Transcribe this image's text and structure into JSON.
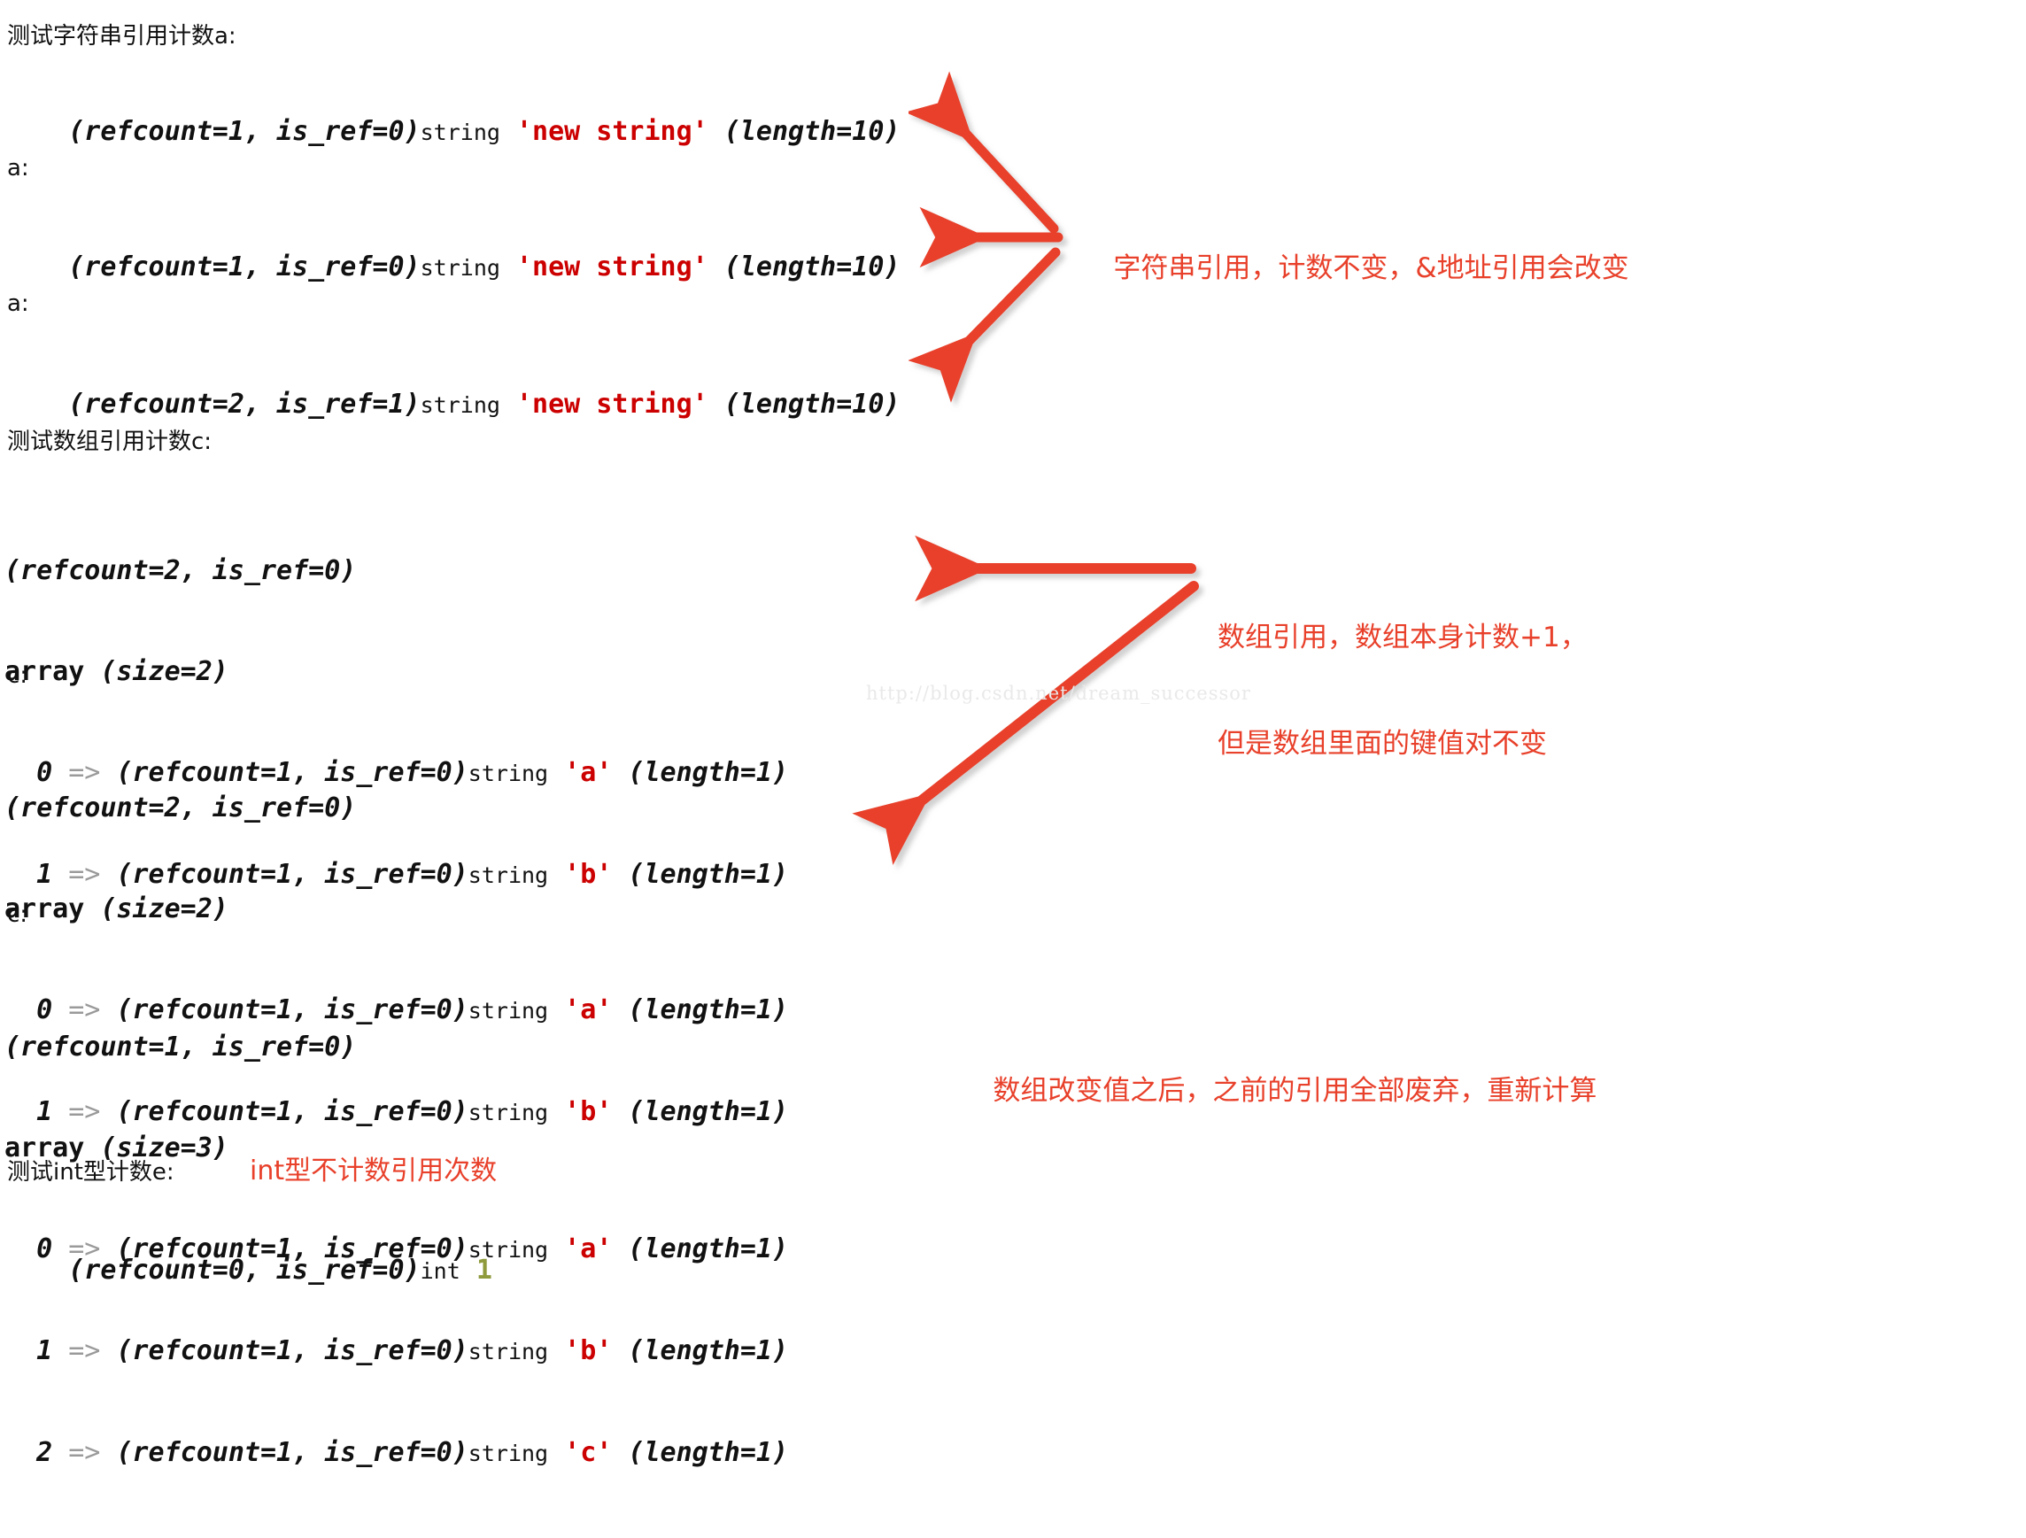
{
  "page": {
    "background": "#ffffff",
    "accent_red": "#e8402a",
    "string_red": "#cc0000",
    "int_green": "#8f9a3c",
    "watermark": "http://blog.csdn.net/dream_successor"
  },
  "sections": {
    "string_test": {
      "heading": "测试字符串引用计数a:",
      "dumps": [
        {
          "meta": "(refcount=1, is_ref=0)",
          "type": "string",
          "value": "'new string'",
          "length": "(length=10)"
        },
        {
          "meta": "(refcount=1, is_ref=0)",
          "type": "string",
          "value": "'new string'",
          "length": "(length=10)"
        },
        {
          "meta": "(refcount=2, is_ref=1)",
          "type": "string",
          "value": "'new string'",
          "length": "(length=10)"
        }
      ],
      "var_labels": [
        "a:",
        "a:"
      ]
    },
    "array_test": {
      "heading": "测试数组引用计数c:",
      "var_labels": [
        "c:",
        "c:"
      ],
      "dumps": [
        {
          "meta": "(refcount=2, is_ref=0)",
          "array_kw": "array",
          "size": "(size=2)",
          "items": [
            {
              "key": "0",
              "op": "=>",
              "meta": "(refcount=1, is_ref=0)",
              "type": "string",
              "value": "'a'",
              "length": "(length=1)"
            },
            {
              "key": "1",
              "op": "=>",
              "meta": "(refcount=1, is_ref=0)",
              "type": "string",
              "value": "'b'",
              "length": "(length=1)"
            }
          ]
        },
        {
          "meta": "(refcount=2, is_ref=0)",
          "array_kw": "array",
          "size": "(size=2)",
          "items": [
            {
              "key": "0",
              "op": "=>",
              "meta": "(refcount=1, is_ref=0)",
              "type": "string",
              "value": "'a'",
              "length": "(length=1)"
            },
            {
              "key": "1",
              "op": "=>",
              "meta": "(refcount=1, is_ref=0)",
              "type": "string",
              "value": "'b'",
              "length": "(length=1)"
            }
          ]
        },
        {
          "meta": "(refcount=1, is_ref=0)",
          "array_kw": "array",
          "size": "(size=3)",
          "items": [
            {
              "key": "0",
              "op": "=>",
              "meta": "(refcount=1, is_ref=0)",
              "type": "string",
              "value": "'a'",
              "length": "(length=1)"
            },
            {
              "key": "1",
              "op": "=>",
              "meta": "(refcount=1, is_ref=0)",
              "type": "string",
              "value": "'b'",
              "length": "(length=1)"
            },
            {
              "key": "2",
              "op": "=>",
              "meta": "(refcount=1, is_ref=0)",
              "type": "string",
              "value": "'c'",
              "length": "(length=1)"
            }
          ]
        }
      ]
    },
    "int_test": {
      "heading": "测试int型计数e:",
      "inline_note": "int型不计数引用次数",
      "dump": {
        "meta": "(refcount=0, is_ref=0)",
        "type": "int",
        "value": "1"
      }
    }
  },
  "annotations": [
    {
      "id": "note-string",
      "line1": "字符串引用，计数不变，&地址引用会改变",
      "line2": ""
    },
    {
      "id": "note-array",
      "line1": "数组引用，数组本身计数+1，",
      "line2": "但是数组里面的键值对不变"
    },
    {
      "id": "note-rebuild",
      "line1": "数组改变值之后，之前的引用全部废弃，重新计算",
      "line2": ""
    }
  ]
}
